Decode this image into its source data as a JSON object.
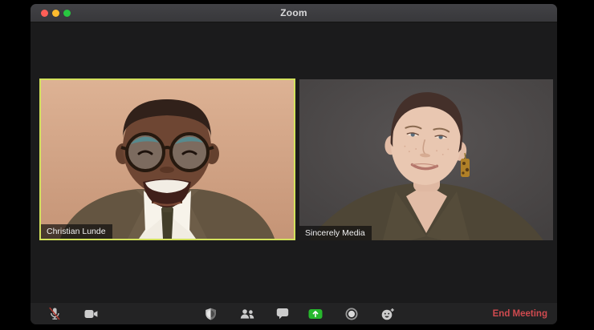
{
  "window": {
    "title": "Zoom"
  },
  "video_grid": {
    "tiles": [
      {
        "name": "Christian Lunde",
        "active_speaker": true
      },
      {
        "name": "Sincerely Media",
        "active_speaker": false
      }
    ]
  },
  "toolbar": {
    "icons": [
      "microphone-muted-icon",
      "video-camera-icon",
      "security-shield-icon",
      "participants-icon",
      "chat-icon",
      "share-screen-icon",
      "record-icon",
      "reactions-icon"
    ],
    "end_meeting_label": "End Meeting"
  },
  "colors": {
    "active_speaker_border": "#d3e15c",
    "end_meeting_red": "#cf4a4f",
    "share_screen_green": "#27b82d",
    "traffic_red": "#ff5f57",
    "traffic_yellow": "#febc2e",
    "traffic_green": "#28c840",
    "icon_gray": "#c9c9c9"
  }
}
